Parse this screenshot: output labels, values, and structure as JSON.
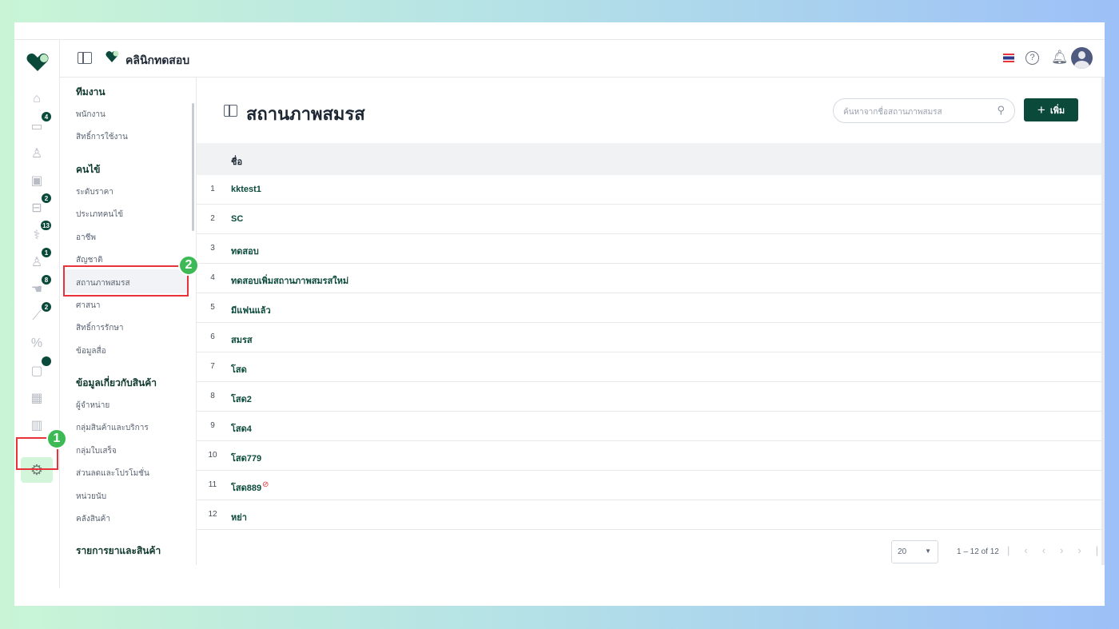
{
  "header": {
    "clinic_name": "คลินิกทดสอบ"
  },
  "rail": {
    "badges": {
      "calendar": "4",
      "treatment": "2",
      "stethoscope": "13",
      "doctor": "1",
      "hand": "8",
      "pill": "2"
    }
  },
  "menu": {
    "sections": [
      {
        "title": "ทีมงาน",
        "items": [
          "พนักงาน",
          "สิทธิ์การใช้งาน"
        ]
      },
      {
        "title": "คนไข้",
        "items": [
          "ระดับราคา",
          "ประเภทคนไข้",
          "อาชีพ",
          "สัญชาติ",
          "สถานภาพสมรส",
          "ศาสนา",
          "สิทธิ์การรักษา",
          "ข้อมูลสื่อ"
        ]
      },
      {
        "title": "ข้อมูลเกี่ยวกับสินค้า",
        "items": [
          "ผู้จำหน่าย",
          "กลุ่มสินค้าและบริการ",
          "กลุ่มใบเสร็จ",
          "ส่วนลดและโปรโมชั่น",
          "หน่วยนับ",
          "คลังสินค้า"
        ]
      },
      {
        "title": "รายการยาและสินค้า",
        "items": []
      }
    ],
    "active": "สถานภาพสมรส"
  },
  "main": {
    "title": "สถานภาพสมรส",
    "search_placeholder": "ค้นหาจากชื่อสถานภาพสมรส",
    "add_label": "เพิ่ม",
    "column_name": "ชื่อ",
    "rows": [
      {
        "n": "1",
        "name": "kktest1"
      },
      {
        "n": "2",
        "name": "SC"
      },
      {
        "n": "3",
        "name": "ทดสอบ"
      },
      {
        "n": "4",
        "name": "ทดสอบเพิ่มสถานภาพสมรสใหม่"
      },
      {
        "n": "5",
        "name": "มีแฟนแล้ว"
      },
      {
        "n": "6",
        "name": "สมรส"
      },
      {
        "n": "7",
        "name": "โสด"
      },
      {
        "n": "8",
        "name": "โสด2"
      },
      {
        "n": "9",
        "name": "โสด4"
      },
      {
        "n": "10",
        "name": "โสด779"
      },
      {
        "n": "11",
        "name": "โสด889",
        "disabled": true
      },
      {
        "n": "12",
        "name": "หย่า"
      }
    ],
    "page_size": "20",
    "range": "1 – 12 of 12"
  },
  "annotations": {
    "step1": "1",
    "step2": "2"
  },
  "colors": {
    "brand": "#0b4a3a",
    "annotation_red": "#e8333a",
    "annotation_green": "#3dba55"
  }
}
